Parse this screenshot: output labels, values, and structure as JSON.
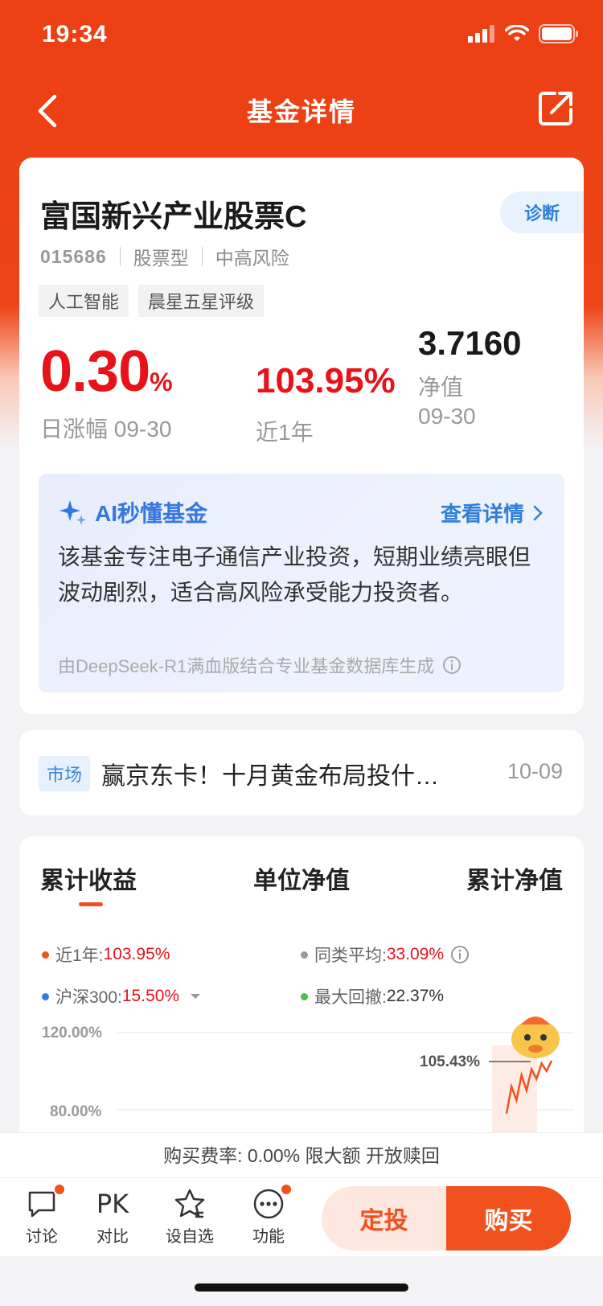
{
  "status": {
    "time": "19:34"
  },
  "nav": {
    "title": "基金详情"
  },
  "fund": {
    "name": "富国新兴产业股票C",
    "code": "015686",
    "type": "股票型",
    "risk": "中高风险",
    "tags": [
      "人工智能",
      "晨星五星评级"
    ],
    "diagnose_label": "诊断",
    "daily_change": "0.30",
    "daily_change_unit": "%",
    "daily_label": "日涨幅 09-30",
    "year_return": "103.95%",
    "year_label": "近1年",
    "nav_value": "3.7160",
    "nav_label": "净值",
    "nav_date": "09-30"
  },
  "ai": {
    "title": "AI秒懂基金",
    "more": "查看详情",
    "text": "该基金专注电子通信产业投资，短期业绩亮眼但波动剧烈，适合高风险承受能力投资者。",
    "source": "由DeepSeek-R1满血版结合专业基金数据库生成"
  },
  "news": {
    "badge": "市场",
    "headline": "赢京东卡！十月黄金布局投什…",
    "date": "10-09"
  },
  "chart": {
    "tabs": [
      "累计收益",
      "单位净值",
      "累计净值"
    ],
    "legend": [
      {
        "label": "近1年:",
        "value": "103.95%",
        "color": "#f0511d"
      },
      {
        "label": "同类平均:",
        "value": "33.09%",
        "color": "#999999"
      },
      {
        "label": "沪深300:",
        "value": "15.50%",
        "color": "#2f7fd8"
      },
      {
        "label": "最大回撤:",
        "value": "22.37%",
        "color": "#4cbf4c"
      }
    ],
    "y_ticks": [
      "120.00%",
      "80.00%"
    ],
    "callout": "105.43%"
  },
  "chart_data": {
    "type": "line",
    "ylim": [
      80,
      120
    ],
    "y_ticks": [
      "120.00%",
      "80.00%"
    ],
    "series": [
      {
        "name": "近1年",
        "values": [
          78,
          92,
          85,
          98,
          90,
          101,
          96,
          104,
          100,
          105.43
        ]
      }
    ],
    "annotation": "105.43%"
  },
  "fee": {
    "text": "购买费率: 0.00% 限大额 开放赎回"
  },
  "toolbar": {
    "discuss": "讨论",
    "compare_icon": "PK",
    "compare": "对比",
    "watch": "设自选",
    "more": "功能",
    "dingtou": "定投",
    "buy": "购买"
  }
}
